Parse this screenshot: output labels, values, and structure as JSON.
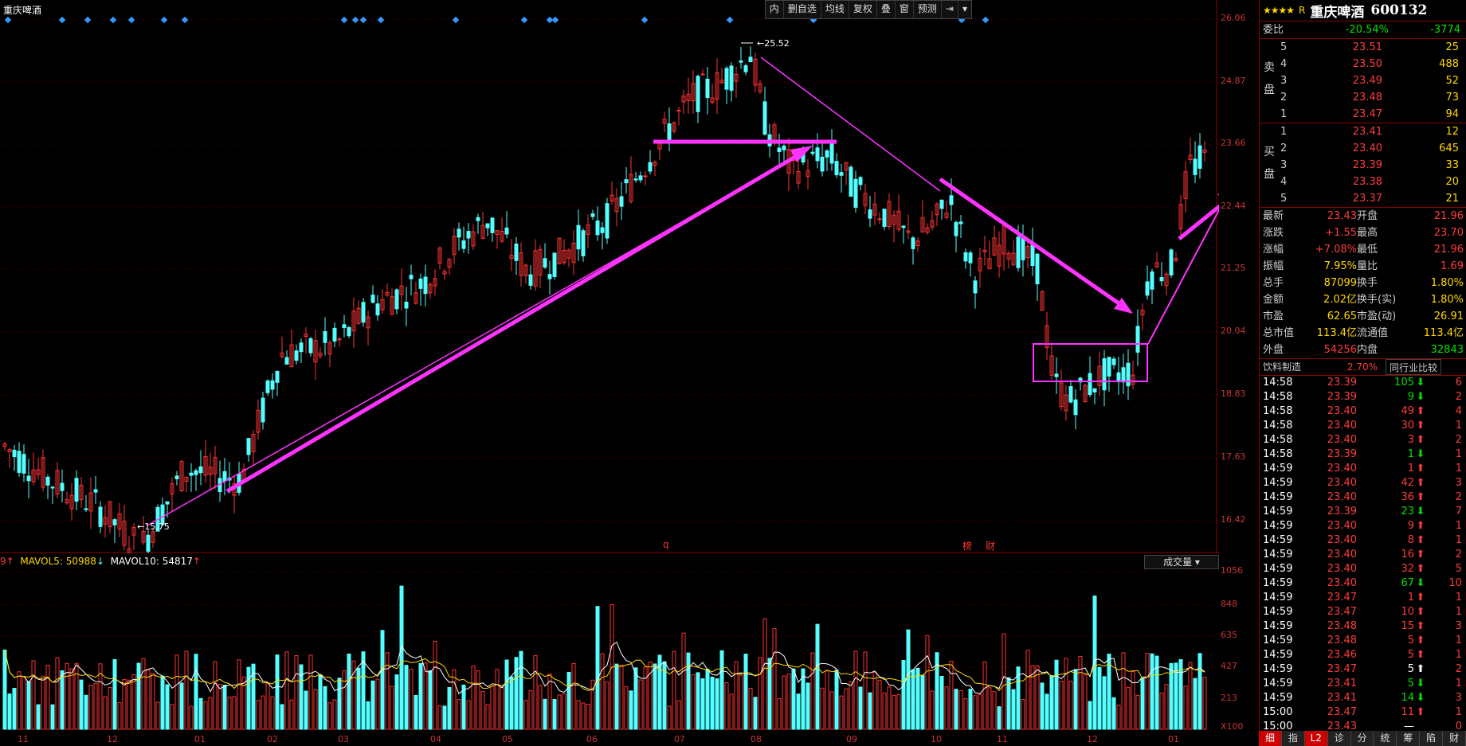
{
  "chart": {
    "title": "重庆啤酒",
    "toolbar": [
      "内",
      "删自选",
      "均线",
      "复权",
      "叠",
      "窗",
      "预测"
    ],
    "price_axis": [
      "26.06",
      "24.87",
      "23.66",
      "22.44",
      "21.25",
      "20.04",
      "18.83",
      "17.63",
      "16.42"
    ],
    "vol_axis": [
      "1056",
      "848",
      "635",
      "427",
      "213",
      "X100"
    ],
    "months": [
      "11",
      "12",
      "01",
      "02",
      "03",
      "04",
      "05",
      "06",
      "07",
      "08",
      "09",
      "10",
      "11",
      "12",
      "01"
    ],
    "high_mark": "25.52",
    "low_mark": "15.75",
    "vol_legend": {
      "prefix": "9",
      "ma5_label": "MAVOL5: 50988",
      "ma10_label": "MAVOL10: 54817"
    },
    "vol_select": "成交量",
    "event_tags": [
      "q",
      "榜",
      "财"
    ],
    "colors": {
      "up": "#ff3232",
      "down": "#54ffff",
      "annot": "#ff33ff",
      "ma5": "#ffffff",
      "ma10": "#ffd800"
    }
  },
  "panel": {
    "stars": "★★★★",
    "r_label": "R",
    "stock_name": "重庆啤酒",
    "stock_code": "600132",
    "weibi": {
      "label": "委比",
      "pct": "-20.54%",
      "diff": "-3774"
    },
    "sell_label": "卖盘",
    "buy_label": "买盘",
    "sell": [
      {
        "lvl": "5",
        "price": "23.51",
        "vol": "25"
      },
      {
        "lvl": "4",
        "price": "23.50",
        "vol": "488"
      },
      {
        "lvl": "3",
        "price": "23.49",
        "vol": "52"
      },
      {
        "lvl": "2",
        "price": "23.48",
        "vol": "73"
      },
      {
        "lvl": "1",
        "price": "23.47",
        "vol": "94"
      }
    ],
    "buy": [
      {
        "lvl": "1",
        "price": "23.41",
        "vol": "12"
      },
      {
        "lvl": "2",
        "price": "23.40",
        "vol": "645"
      },
      {
        "lvl": "3",
        "price": "23.39",
        "vol": "33"
      },
      {
        "lvl": "4",
        "price": "23.38",
        "vol": "20"
      },
      {
        "lvl": "5",
        "price": "23.37",
        "vol": "21"
      }
    ],
    "stats": [
      {
        "l1": "最新",
        "v1": "23.43",
        "l2": "开盘",
        "v2": "21.96"
      },
      {
        "l1": "涨跌",
        "v1": "+1.55",
        "l2": "最高",
        "v2": "23.70"
      },
      {
        "l1": "涨幅",
        "v1": "+7.08%",
        "l2": "最低",
        "v2": "21.96"
      },
      {
        "l1": "振幅",
        "v1": "7.95%",
        "l2": "量比",
        "v2": "1.69"
      },
      {
        "l1": "总手",
        "v1": "87099",
        "l2": "换手",
        "v2": "1.80%"
      },
      {
        "l1": "金额",
        "v1": "2.02亿",
        "l2": "换手(实)",
        "v2": "1.80%"
      },
      {
        "l1": "市盈",
        "v1": "62.65",
        "l2": "市盈(动)",
        "v2": "26.91"
      },
      {
        "l1": "总市值",
        "v1": "113.4亿",
        "l2": "流通值",
        "v2": "113.4亿"
      },
      {
        "l1": "外盘",
        "v1": "54256",
        "l2": "内盘",
        "v2": "32843"
      }
    ],
    "industry": {
      "name": "饮料制造",
      "pct": "2.70%",
      "compare": "同行业比较"
    },
    "ticks": [
      {
        "t": "14:58",
        "p": "23.39",
        "v": "105",
        "d": "down",
        "n": "6"
      },
      {
        "t": "14:58",
        "p": "23.39",
        "v": "9",
        "d": "down",
        "n": "2"
      },
      {
        "t": "14:58",
        "p": "23.40",
        "v": "49",
        "d": "up",
        "n": "4"
      },
      {
        "t": "14:58",
        "p": "23.40",
        "v": "30",
        "d": "up",
        "n": "1"
      },
      {
        "t": "14:58",
        "p": "23.40",
        "v": "3",
        "d": "up",
        "n": "2"
      },
      {
        "t": "14:58",
        "p": "23.39",
        "v": "1",
        "d": "down",
        "n": "1"
      },
      {
        "t": "14:59",
        "p": "23.40",
        "v": "1",
        "d": "up",
        "n": "1"
      },
      {
        "t": "14:59",
        "p": "23.40",
        "v": "42",
        "d": "up",
        "n": "3"
      },
      {
        "t": "14:59",
        "p": "23.40",
        "v": "36",
        "d": "up",
        "n": "2"
      },
      {
        "t": "14:59",
        "p": "23.39",
        "v": "23",
        "d": "down",
        "n": "7"
      },
      {
        "t": "14:59",
        "p": "23.40",
        "v": "9",
        "d": "up",
        "n": "1"
      },
      {
        "t": "14:59",
        "p": "23.40",
        "v": "8",
        "d": "up",
        "n": "1"
      },
      {
        "t": "14:59",
        "p": "23.40",
        "v": "16",
        "d": "up",
        "n": "2"
      },
      {
        "t": "14:59",
        "p": "23.40",
        "v": "32",
        "d": "up",
        "n": "5"
      },
      {
        "t": "14:59",
        "p": "23.40",
        "v": "67",
        "d": "down",
        "n": "10"
      },
      {
        "t": "14:59",
        "p": "23.47",
        "v": "1",
        "d": "up",
        "n": "1"
      },
      {
        "t": "14:59",
        "p": "23.47",
        "v": "10",
        "d": "up",
        "n": "1"
      },
      {
        "t": "14:59",
        "p": "23.48",
        "v": "15",
        "d": "up",
        "n": "3"
      },
      {
        "t": "14:59",
        "p": "23.48",
        "v": "5",
        "d": "up",
        "n": "1"
      },
      {
        "t": "14:59",
        "p": "23.46",
        "v": "5",
        "d": "up",
        "n": "1"
      },
      {
        "t": "14:59",
        "p": "23.47",
        "v": "5",
        "d": "white",
        "n": "2"
      },
      {
        "t": "14:59",
        "p": "23.41",
        "v": "5",
        "d": "down",
        "n": "1"
      },
      {
        "t": "14:59",
        "p": "23.41",
        "v": "14",
        "d": "down",
        "n": "3"
      },
      {
        "t": "15:00",
        "p": "23.47",
        "v": "11",
        "d": "up",
        "n": "1"
      },
      {
        "t": "15:00",
        "p": "23.43",
        "v": "",
        "d": "none",
        "n": "0"
      }
    ],
    "tabs": [
      "细",
      "指",
      "L2",
      "诊",
      "分",
      "统",
      "筹",
      "陷",
      "财"
    ]
  }
}
